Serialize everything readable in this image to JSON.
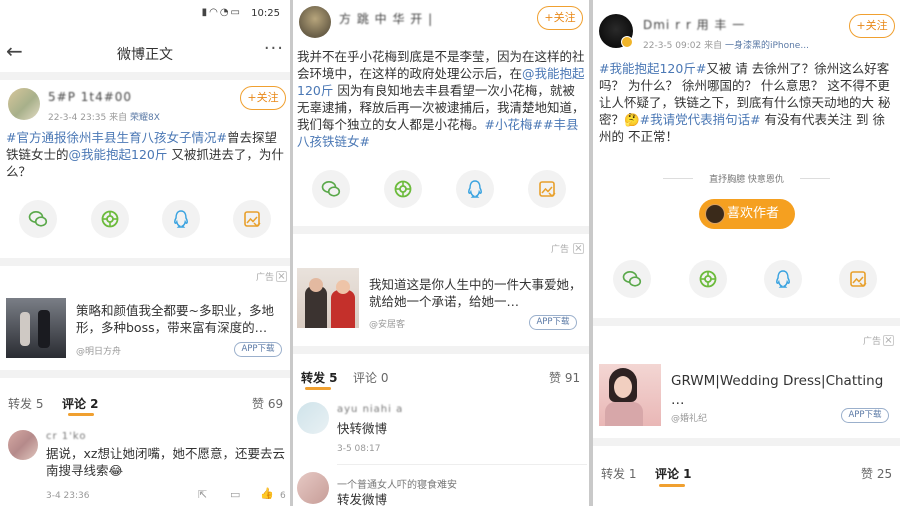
{
  "colors": {
    "accent": "#f0a030",
    "link": "#4b78b5",
    "share_bg": "#f2f2f2"
  },
  "panel1": {
    "status": {
      "time": "10:25",
      "icons": [
        "sim-icon",
        "wifi-icon",
        "alarm-icon",
        "battery-icon"
      ]
    },
    "nav": {
      "title": "微博正文",
      "back_icon": "back-arrow-icon",
      "more_icon": "more-dots-icon"
    },
    "post": {
      "username": "5#P 1t4#00",
      "meta_time": "22-3-4 23:35",
      "meta_from": "来自",
      "meta_device": "荣耀8X",
      "follow": "+关注",
      "tag1": "#官方通报徐州丰县生育八孩女子情况#",
      "text1": "曾去探望铁链女士的",
      "mention": "@我能抱起120斤",
      "text2": " 又被抓进去了，为什么？"
    },
    "share_icons": [
      "wechat-icon",
      "moments-icon",
      "qq-icon",
      "save-image-icon"
    ],
    "ad": {
      "label": "广告",
      "close": "×",
      "text": "策略和颜值我全都要~多职业，多地形，多种boss，带来富有深度的…",
      "source": "@明日方舟",
      "button": "APP下载"
    },
    "tabs": {
      "repost": "转发 5",
      "comment": "评论 2",
      "like": "赞 69"
    },
    "comment": {
      "name": "cr 1'ko",
      "text": "据说，xz想让她闭嘴，她不愿意，还要去云南搜寻线索😂",
      "time": "3-4 23:36",
      "like_count": "6"
    }
  },
  "panel2": {
    "post": {
      "username": "方 跳 中 华 开 |",
      "follow": "+关注",
      "text1": "我并不在乎小花梅到底是不是李莹，因为在这样的社会环境中，在这样的政府处理公示后，在",
      "mention": "@我能抱起120斤",
      "text2": " 因为有良知地去丰县看望一次小花梅，就被无辜逮捕，释放后再一次被逮捕后，我清楚地知道，我们每个独立的女人都是小花梅。",
      "tag1": "#小花梅#",
      "tag2": "#丰县八孩铁链女#"
    },
    "share_icons": [
      "wechat-icon",
      "moments-icon",
      "qq-icon",
      "save-image-icon"
    ],
    "ad": {
      "label": "广告",
      "close": "×",
      "text": "我知道这是你人生中的一件大事爱她，就给她一个承诺，给她一…",
      "source": "@安居客",
      "button": "APP下载"
    },
    "tabs": {
      "repost": "转发 5",
      "comment": "评论 0",
      "like": "赞 91"
    },
    "reposts": [
      {
        "name": "ayu niahi a",
        "text": "快转微博",
        "time": "3-5 08:17"
      },
      {
        "name": "一个普通女人吓的寝食难安",
        "text": "转发微博",
        "time": ""
      }
    ]
  },
  "panel3": {
    "post": {
      "username": "Dmi r r 用 丰 一",
      "meta_time": "22-3-5 09:02",
      "meta_from": "来自",
      "meta_device": "一身漆黑的iPhone...",
      "follow": "+关注",
      "tag1": "#我能抱起120斤#",
      "text1": "又被 请 去徐州了？徐州这么好客吗？ 为什么？ 徐州哪国的？ 什么意思？ 这不得不更让人怀疑了，铁链之下，到底有什么惊天动地的大 秘密？",
      "emoji": "🤔",
      "tag2": "#我请党代表捎句话#",
      "text2": " 有没有代表关注 到 徐州的 不正常！"
    },
    "reward": {
      "note": "直抒胸臆 快意恩仇",
      "button": "喜欢作者"
    },
    "share_icons": [
      "wechat-icon",
      "moments-icon",
      "qq-icon",
      "save-image-icon"
    ],
    "ad": {
      "label": "广告",
      "close": "×",
      "text": "GRWM|Wedding Dress|Chatting …",
      "source": "@婚礼纪",
      "button": "APP下载"
    },
    "tabs": {
      "repost": "转发 1",
      "comment": "评论 1",
      "like": "赞 25"
    }
  }
}
